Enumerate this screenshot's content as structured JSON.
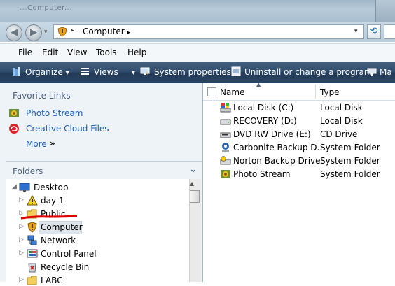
{
  "window": {
    "title_fragment": "...Computer..."
  },
  "nav": {
    "back_glyph": "◀",
    "forward_glyph": "▶",
    "dropdown_glyph": "▾"
  },
  "address": {
    "arrow": "▸",
    "location": "Computer",
    "trailing_arrow": "▸",
    "dropdown": "▾",
    "refresh_glyph": "⟲"
  },
  "menu": [
    "File",
    "Edit",
    "View",
    "Tools",
    "Help"
  ],
  "toolbar": {
    "organize": "Organize",
    "views": "Views",
    "system_properties": "System properties",
    "uninstall": "Uninstall or change a program",
    "overflow": "Ma",
    "dropdown_glyph": "▾"
  },
  "favorites": {
    "header": "Favorite Links",
    "items": [
      "Photo Stream",
      "Creative Cloud Files"
    ],
    "more": "More",
    "more_glyph": "»"
  },
  "folders": {
    "header": "Folders",
    "chevron": "⌄",
    "tree": [
      {
        "label": "Desktop",
        "expanded": true,
        "icon": "desktop-icon"
      },
      {
        "label": "day 1",
        "icon": "warning-icon"
      },
      {
        "label": "Public",
        "icon": "folder-icon"
      },
      {
        "label": "Computer",
        "icon": "shield-icon",
        "selected": true
      },
      {
        "label": "Network",
        "icon": "network-icon"
      },
      {
        "label": "Control Panel",
        "icon": "control-panel-icon"
      },
      {
        "label": "Recycle Bin",
        "icon": "recycle-bin-icon"
      },
      {
        "label": "LABC",
        "icon": "folder-icon"
      }
    ]
  },
  "list": {
    "columns": [
      "Name",
      "Type"
    ],
    "rows": [
      {
        "name": "Local Disk (C:)",
        "type": "Local Disk",
        "icon": "system-drive-icon"
      },
      {
        "name": "RECOVERY (D:)",
        "type": "Local Disk",
        "icon": "drive-icon"
      },
      {
        "name": "DVD RW Drive (E:)",
        "type": "CD Drive",
        "icon": "dvd-drive-icon"
      },
      {
        "name": "Carbonite Backup D...",
        "type": "System Folder",
        "icon": "carbonite-icon"
      },
      {
        "name": "Norton Backup Drive",
        "type": "System Folder",
        "icon": "norton-icon"
      },
      {
        "name": "Photo Stream",
        "type": "System Folder",
        "icon": "photo-stream-icon"
      }
    ]
  },
  "colors": {
    "toolbar": "#2f4b6b",
    "link": "#1c5cb8",
    "annotation": "#e00000",
    "nav_pane": "#eef3f8"
  }
}
